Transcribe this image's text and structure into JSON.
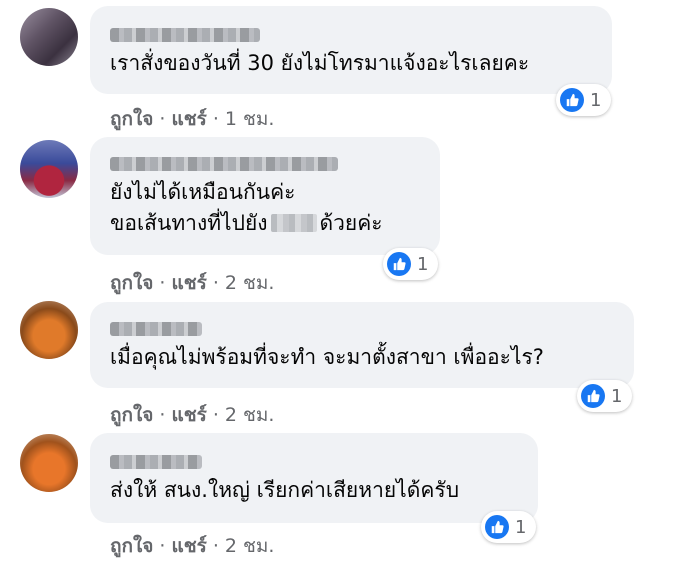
{
  "comments": [
    {
      "text": "เราสั่งของวันที่ 30 ยังไม่โทรมาแจ้งอะไรเลยคะ",
      "reaction_count": "1",
      "like_label": "ถูกใจ",
      "share_label": "แชร์",
      "time": "1 ชม."
    },
    {
      "text_line1": "ยังไม่ได้เหมือนกันค่ะ",
      "text_line2_before": "ขอเส้นทางที่ไปยัง",
      "text_line2_after": "ด้วยค่ะ",
      "reaction_count": "1",
      "like_label": "ถูกใจ",
      "share_label": "แชร์",
      "time": "2 ชม."
    },
    {
      "text": "เมื่อคุณไม่พร้อมที่จะทำ จะมาตั้งสาขา เพื่ออะไร?",
      "reaction_count": "1",
      "like_label": "ถูกใจ",
      "share_label": "แชร์",
      "time": "2 ชม."
    },
    {
      "text": "ส่งให้ สนง.ใหญ่ เรียกค่าเสียหายได้ครับ",
      "reaction_count": "1",
      "like_label": "ถูกใจ",
      "share_label": "แชร์",
      "time": "2 ชม."
    }
  ],
  "colors": {
    "bubble": "#f0f2f5",
    "like_blue": "#1877f2",
    "meta_text": "#65676b"
  },
  "icons": {
    "reaction": "like-thumbs-up-icon"
  }
}
